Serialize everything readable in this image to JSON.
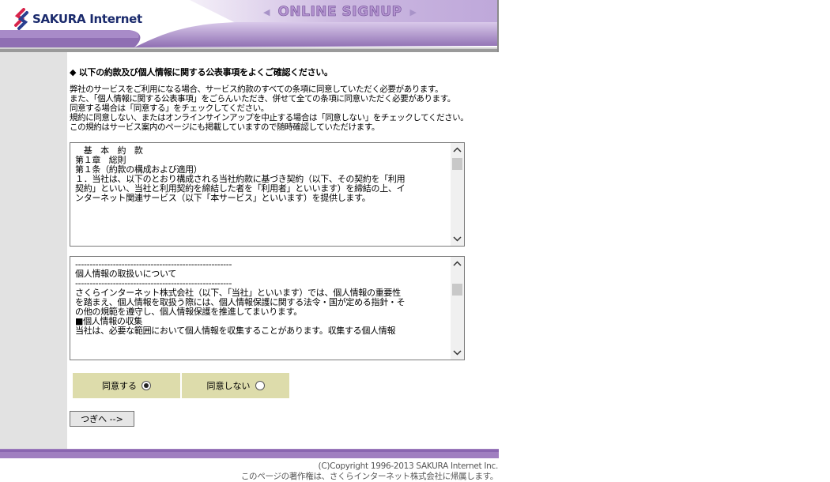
{
  "header": {
    "logo_text": "SAKURA Internet",
    "title": "ONLINE SIGNUP"
  },
  "colors": {
    "header_purple": "#8f6fb3",
    "sidebar_gray": "#e2e2e2",
    "agree_bg": "#dddcab",
    "footer_purple": "#a07fc0"
  },
  "main": {
    "heading": "◆ 以下の約款及び個人情報に関する公表事項をよくご確認ください。",
    "intro_lines": [
      "弊社のサービスをご利用になる場合、サービス約款のすべての条項に同意していただく必要があります。",
      "また、「個人情報に関する公表事項」をごらんいただき、併せて全ての条項に同意いただく必要があります。",
      "同意する場合は「同意する」をチェックしてください。",
      "規約に同意しない、またはオンラインサインアップを中止する場合は「同意しない」をチェックしてください。",
      "この規約はサービス案内のページにも掲載していますので随時確認していただけます。"
    ],
    "terms_box": {
      "lines": [
        "　基　本　約　款",
        "",
        "",
        "第１章　総則",
        "",
        "第１条（約款の構成および適用）",
        "",
        "１．当社は、以下のとおり構成される当社約款に基づき契約（以下、その契約を「利用",
        "契約」といい、当社と利用契約を締結した者を「利用者」といいます）を締結の上、イ",
        "ンターネット関連サービス（以下「本サービス」といいます）を提供します。"
      ]
    },
    "privacy_box": {
      "lines": [
        "------------------------------------------------------",
        "個人情報の取扱いについて",
        "------------------------------------------------------",
        "",
        "",
        "さくらインターネット株式会社（以下、「当社」といいます）では、個人情報の重要性",
        "を踏まえ、個人情報を取扱う際には、個人情報保護に関する法令・国が定める指針・そ",
        "の他の規範を遵守し、個人情報保護を推進してまいります。",
        "",
        "",
        "■個人情報の収集",
        "当社は、必要な範囲において個人情報を収集することがあります。収集する個人情報"
      ]
    },
    "agree": {
      "agree_label": "同意する",
      "disagree_label": "同意しない",
      "selected": "agree"
    },
    "next_button": "つぎへ -->"
  },
  "footer": {
    "copyright_line1": "(C)Copyright 1996-2013 SAKURA Internet Inc.",
    "copyright_line2": "このページの著作権は、さくらインターネット株式会社に帰属します。"
  }
}
